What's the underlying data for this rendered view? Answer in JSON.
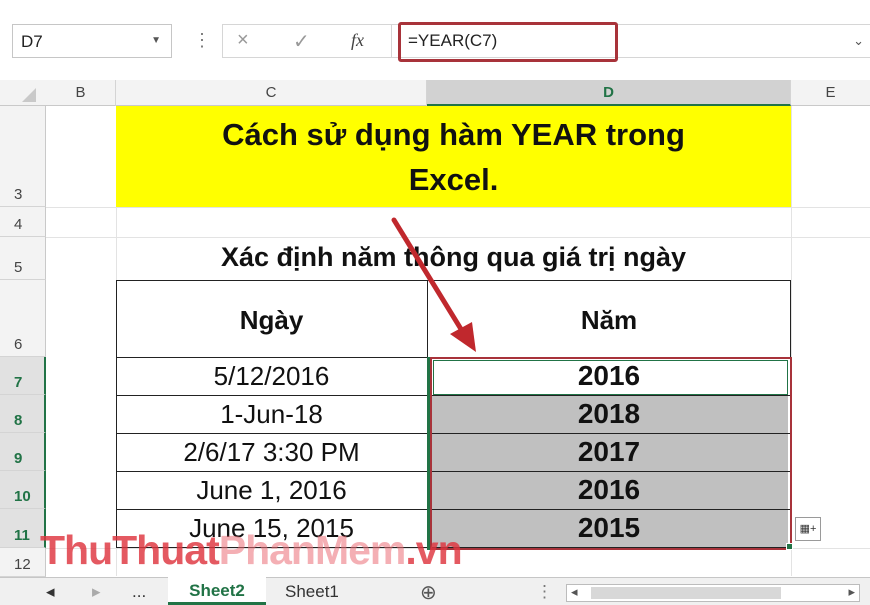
{
  "formula_bar": {
    "name_box": "D7",
    "formula": "=YEAR(C7)",
    "cancel_icon": "×",
    "enter_icon": "✓",
    "fx_label": "fx"
  },
  "columns": [
    "B",
    "C",
    "D",
    "E"
  ],
  "rows": [
    "3",
    "4",
    "5",
    "6",
    "7",
    "8",
    "9",
    "10",
    "11",
    "12"
  ],
  "sheet": {
    "title_line1": "Cách sử dụng hàm YEAR trong",
    "title_line2": "Excel.",
    "subtitle": "Xác định năm thông qua giá trị ngày",
    "headers": {
      "date": "Ngày",
      "year": "Năm"
    },
    "table": [
      {
        "date": "5/12/2016",
        "year": "2016"
      },
      {
        "date": "1-Jun-18",
        "year": "2018"
      },
      {
        "date": "2/6/17 3:30 PM",
        "year": "2017"
      },
      {
        "date": "June 1, 2016",
        "year": "2016"
      },
      {
        "date": "June 15, 2015",
        "year": "2015"
      }
    ]
  },
  "watermark": {
    "part1": "ThuThuat",
    "part2": "PhanMem",
    "part3": ".vn"
  },
  "tabs": {
    "nav_prev": "◂",
    "nav_next": "▸",
    "more": "...",
    "active": "Sheet2",
    "other": "Sheet1",
    "add": "⊕",
    "scroll_left": "◂",
    "scroll_right": "▸"
  },
  "colors": {
    "accent": "#217346",
    "highlight": "#a8333a",
    "title_bg": "#ffff00",
    "selection_fill": "#c0c0c0"
  }
}
